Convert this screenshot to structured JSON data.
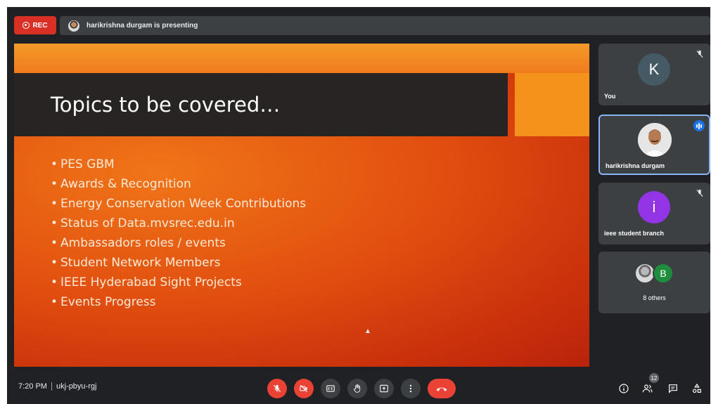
{
  "top_bar": {
    "rec_label": "REC",
    "presenting_text": "harikrishna durgam is presenting"
  },
  "slide": {
    "title": "Topics to be covered…",
    "topics": [
      "PES GBM",
      "Awards & Recognition",
      "Energy Conservation Week Contributions",
      "Status of Data.mvsrec.edu.in",
      "Ambassadors roles / events",
      "Student Network Members",
      "IEEE Hyderabad Sight Projects",
      "Events Progress"
    ]
  },
  "participants": {
    "you": {
      "initial": "K",
      "name": "You",
      "avatar_color": "#455a64",
      "muted": true
    },
    "presenter": {
      "name": "harikrishna durgam",
      "speaking": true
    },
    "ieee": {
      "initial": "i",
      "name": "ieee student branch",
      "avatar_color": "#9334e6",
      "muted": true
    },
    "others": {
      "initial": "B",
      "label": "8 others",
      "avatar_color": "#1e8e3e"
    }
  },
  "bottom_bar": {
    "time": "7:20 PM",
    "meeting_code": "ukj-pbyu-rgj",
    "people_count": "12"
  },
  "colors": {
    "rec_red": "#d93025",
    "control_red": "#ea4335",
    "speaking_blue": "#1a73e8",
    "highlight_border": "#8ab4f8"
  }
}
